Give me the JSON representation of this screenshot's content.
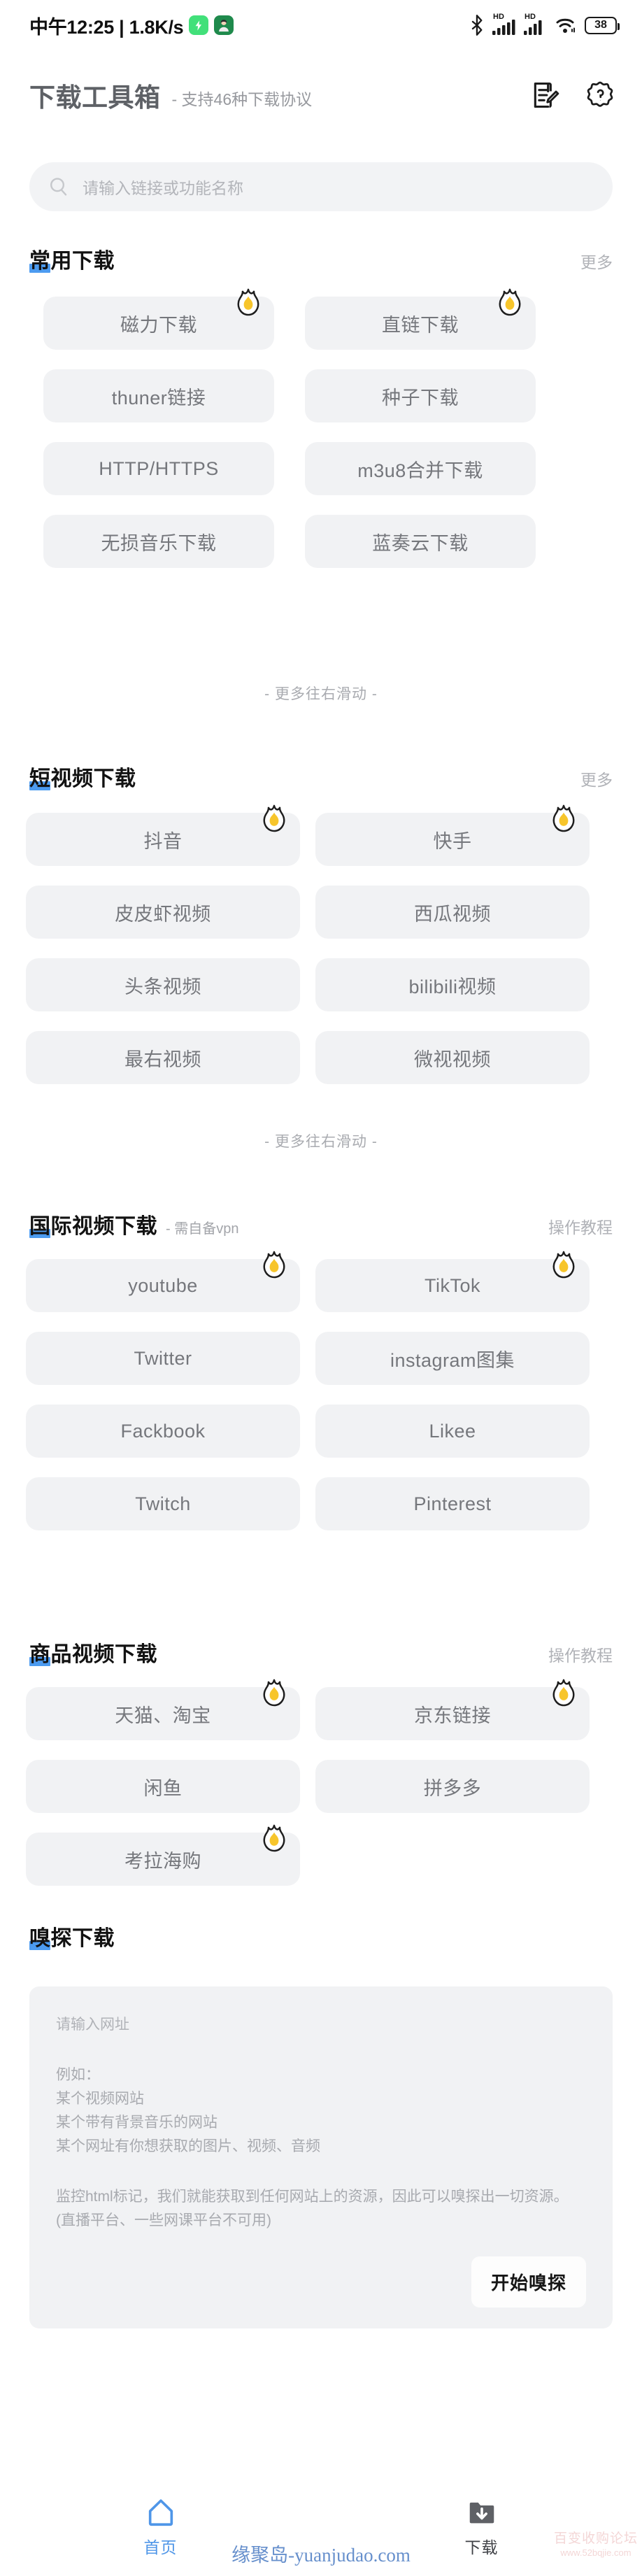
{
  "status_bar": {
    "time_text": "中午12:25 | 1.8K/s",
    "battery_level": "38",
    "hd_label_1": "HD",
    "hd_label_2": "HD"
  },
  "header": {
    "title": "下载工具箱",
    "subtitle": "- 支持46种下载协议"
  },
  "search": {
    "placeholder": "请输入链接或功能名称"
  },
  "sections": [
    {
      "title": "常用下载",
      "note": "",
      "action": "更多",
      "scroll_hint": "- 更多往右滑动 -",
      "tiles": [
        {
          "label": "磁力下载",
          "hot": true
        },
        {
          "label": "直链下载",
          "hot": true
        },
        {
          "label": "thuner链接",
          "hot": false
        },
        {
          "label": "种子下载",
          "hot": false
        },
        {
          "label": "HTTP/HTTPS",
          "hot": false
        },
        {
          "label": "m3u8合并下载",
          "hot": false
        },
        {
          "label": "无损音乐下载",
          "hot": false
        },
        {
          "label": "蓝奏云下载",
          "hot": false
        }
      ]
    },
    {
      "title": "短视频下载",
      "note": "",
      "action": "更多",
      "scroll_hint": "- 更多往右滑动 -",
      "tiles": [
        {
          "label": "抖音",
          "hot": true
        },
        {
          "label": "快手",
          "hot": true
        },
        {
          "label": "皮皮虾视频",
          "hot": false
        },
        {
          "label": "西瓜视频",
          "hot": false
        },
        {
          "label": "头条视频",
          "hot": false
        },
        {
          "label": "bilibili视频",
          "hot": false
        },
        {
          "label": "最右视频",
          "hot": false
        },
        {
          "label": "微视视频",
          "hot": false
        }
      ]
    },
    {
      "title": "国际视频下载",
      "note": "- 需自备vpn",
      "action": "操作教程",
      "scroll_hint": "",
      "tiles": [
        {
          "label": "youtube",
          "hot": true
        },
        {
          "label": "TikTok",
          "hot": true
        },
        {
          "label": "Twitter",
          "hot": false
        },
        {
          "label": "instagram图集",
          "hot": false
        },
        {
          "label": "Fackbook",
          "hot": false
        },
        {
          "label": "Likee",
          "hot": false
        },
        {
          "label": "Twitch",
          "hot": false
        },
        {
          "label": "Pinterest",
          "hot": false
        }
      ]
    },
    {
      "title": "商品视频下载",
      "note": "",
      "action": "操作教程",
      "scroll_hint": "",
      "tiles": [
        {
          "label": "天猫、淘宝",
          "hot": true
        },
        {
          "label": "京东链接",
          "hot": true
        },
        {
          "label": "闲鱼",
          "hot": false
        },
        {
          "label": "拼多多",
          "hot": false
        },
        {
          "label": "考拉海购",
          "hot": true
        }
      ]
    }
  ],
  "sniff": {
    "title": "嗅探下载",
    "input_placeholder": "请输入网址",
    "desc_1": "例如：\n某个视频网站\n某个带有背景音乐的网站\n某个网址有你想获取的图片、视频、音频",
    "desc_2": "监控html标记，我们就能获取到任何网站上的资源，因此可以嗅探出一切资源。(直播平台、一些网课平台不可用)",
    "button_label": "开始嗅探"
  },
  "bottom_nav": {
    "items": [
      {
        "label": "首页",
        "icon": "home-icon",
        "active": true
      },
      {
        "label": "下载",
        "icon": "folder-download-icon",
        "active": false
      }
    ]
  },
  "watermark": {
    "text": "缘聚岛-yuanjudao.com",
    "corner_text_1": "百变收购论坛",
    "corner_text_2": "www.52bqjie.com"
  },
  "colors": {
    "accent_blue": "#4c9bf0",
    "tile_bg": "#f1f2f4",
    "flame_fill": "#f7c52b"
  }
}
